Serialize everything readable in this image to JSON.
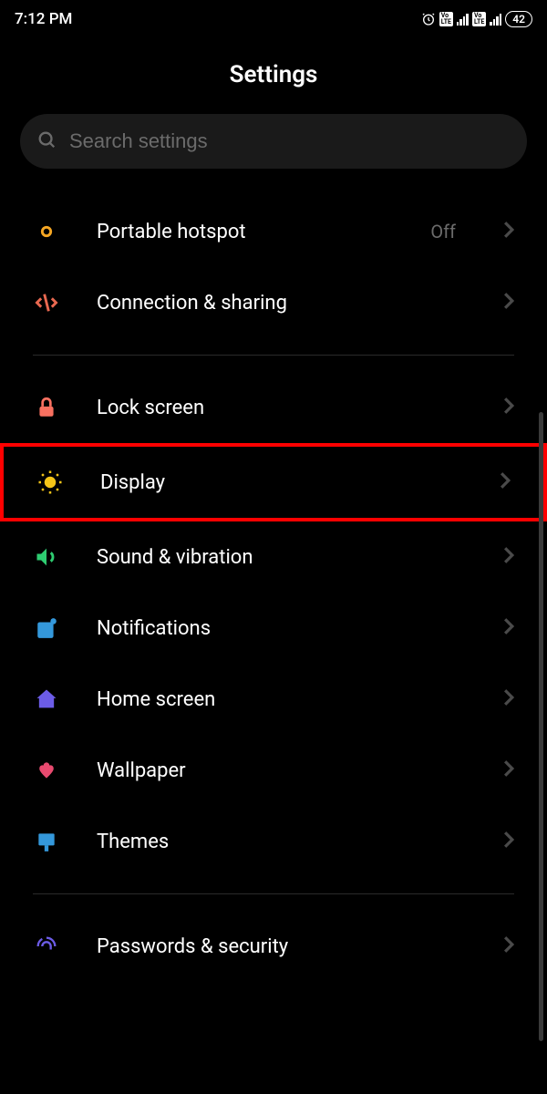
{
  "status": {
    "time": "7:12 PM",
    "battery": "42"
  },
  "page_title": "Settings",
  "search": {
    "placeholder": "Search settings"
  },
  "items": [
    {
      "label": "Portable hotspot",
      "value": "Off"
    },
    {
      "label": "Connection & sharing",
      "value": null
    },
    {
      "label": "Lock screen",
      "value": null
    },
    {
      "label": "Display",
      "value": null
    },
    {
      "label": "Sound & vibration",
      "value": null
    },
    {
      "label": "Notifications",
      "value": null
    },
    {
      "label": "Home screen",
      "value": null
    },
    {
      "label": "Wallpaper",
      "value": null
    },
    {
      "label": "Themes",
      "value": null
    },
    {
      "label": "Passwords & security",
      "value": null
    }
  ]
}
